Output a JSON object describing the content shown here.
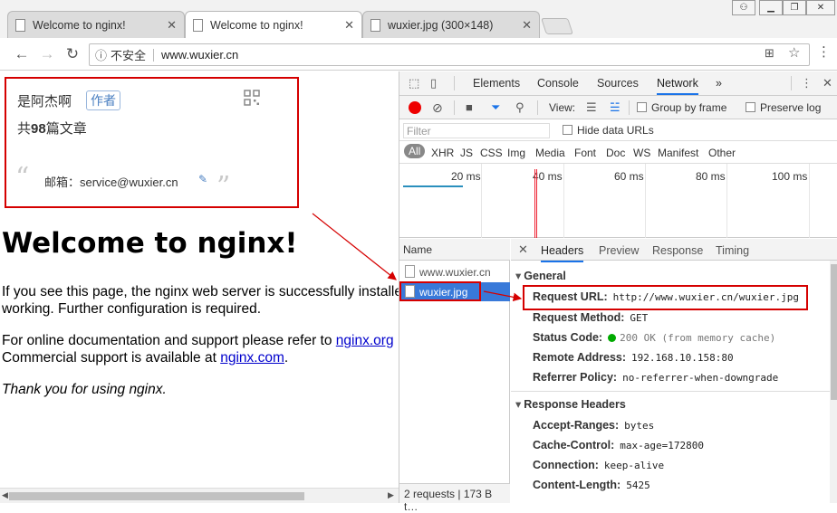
{
  "browser": {
    "tabs": [
      {
        "title": "Welcome to nginx!",
        "active": false
      },
      {
        "title": "Welcome to nginx!",
        "active": true
      },
      {
        "title": "wuxier.jpg (300×148)",
        "active": false
      }
    ],
    "window_controls": [
      "user",
      "minimize",
      "restore",
      "close"
    ],
    "address": {
      "security_label": "不安全",
      "url": "www.wuxier.cn"
    }
  },
  "author_card": {
    "name": "是阿杰啊",
    "tag": "作者",
    "count_prefix": "共",
    "count": "98",
    "count_suffix": "篇文章",
    "email": "邮箱：service@wuxier.cn"
  },
  "nginx_page": {
    "heading": "Welcome to nginx!",
    "para1_line1": "If you see this page, the nginx web server is successfully installed and",
    "para1_line2": "working. Further configuration is required.",
    "para2_prefix": "For online documentation and support please refer to ",
    "para2_link": "nginx.org",
    "para2_line2_prefix": "Commercial support is available at ",
    "para2_line2_link": "nginx.com",
    "para2_line2_suffix": ".",
    "thanks": "Thank you for using nginx."
  },
  "devtools": {
    "tabs": [
      "Elements",
      "Console",
      "Sources",
      "Network"
    ],
    "active_tab": "Network",
    "more": "»",
    "view_label": "View:",
    "group_by_frame": "Group by frame",
    "preserve_log": "Preserve log",
    "filter_placeholder": "Filter",
    "hide_data_urls": "Hide data URLs",
    "types": [
      "All",
      "XHR",
      "JS",
      "CSS",
      "Img",
      "Media",
      "Font",
      "Doc",
      "WS",
      "Manifest",
      "Other"
    ],
    "timeline_ticks": [
      "20 ms",
      "40 ms",
      "60 ms",
      "80 ms",
      "100 ms"
    ],
    "name_header": "Name",
    "requests": [
      {
        "name": "www.wuxier.cn",
        "selected": false
      },
      {
        "name": "wuxier.jpg",
        "selected": true
      }
    ],
    "summary": "2 requests | 173 B t…",
    "detail_tabs": [
      "Headers",
      "Preview",
      "Response",
      "Timing"
    ],
    "general_title": "General",
    "general": [
      {
        "key": "Request URL:",
        "value": "http://www.wuxier.cn/wuxier.jpg"
      },
      {
        "key": "Request Method:",
        "value": "GET"
      },
      {
        "key": "Status Code:",
        "value": "200 OK (from memory cache)"
      },
      {
        "key": "Remote Address:",
        "value": "192.168.10.158:80"
      },
      {
        "key": "Referrer Policy:",
        "value": "no-referrer-when-downgrade"
      }
    ],
    "response_title": "Response Headers",
    "response_headers": [
      {
        "key": "Accept-Ranges:",
        "value": "bytes"
      },
      {
        "key": "Cache-Control:",
        "value": "max-age=172800"
      },
      {
        "key": "Connection:",
        "value": "keep-alive"
      },
      {
        "key": "Content-Length:",
        "value": "5425"
      }
    ]
  },
  "colors": {
    "annotation": "#d50000",
    "selection": "#3879d9",
    "status_ok": "#00aa00",
    "link": "#0000cc"
  }
}
